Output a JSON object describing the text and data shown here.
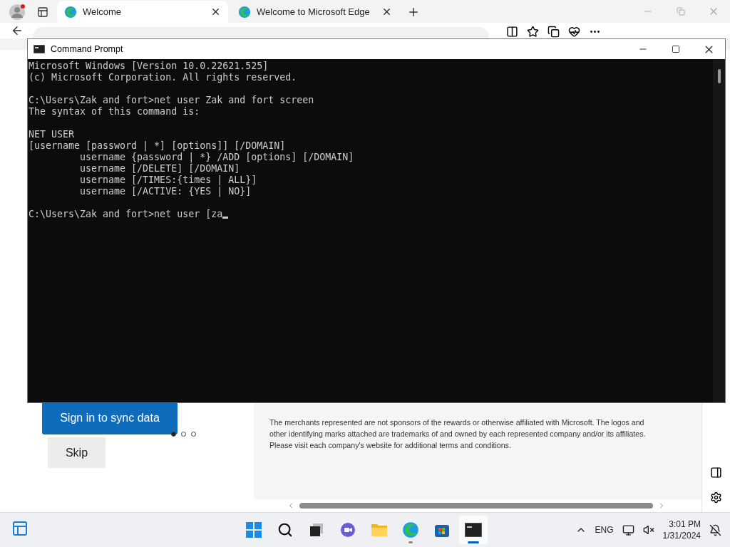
{
  "browser": {
    "tabs": [
      {
        "label": "Welcome",
        "selected": true
      },
      {
        "label": "Welcome to Microsoft Edge",
        "selected": false
      }
    ],
    "page": {
      "sign_in_button": "Sign in to sync data",
      "skip_button": "Skip",
      "carousel_dots": [
        {
          "selected": true
        },
        {
          "selected": false
        },
        {
          "selected": false
        }
      ],
      "disclaimer": "The merchants represented are not sponsors of the rewards or otherwise affiliated with Microsoft. The logos and other identifying marks attached are trademarks of and owned by each represented company and/or its affiliates. Please visit each company's website for additional terms and conditions."
    }
  },
  "command_prompt": {
    "title": "Command Prompt",
    "cursor": true,
    "blocks": [
      [
        "Microsoft Windows [Version 10.0.22621.525]",
        "(c) Microsoft Corporation. All rights reserved."
      ],
      [
        "C:\\Users\\Zak and fort>net user Zak and fort screen",
        "The syntax of this command is:"
      ],
      [
        "NET USER",
        "[username [password | *] [options]] [/DOMAIN]",
        "         username {password | *} /ADD [options] [/DOMAIN]",
        "         username [/DELETE] [/DOMAIN]",
        "         username [/TIMES:{times | ALL}]",
        "         username [/ACTIVE: {YES | NO}]"
      ],
      [
        "C:\\Users\\Zak and fort>net user [za"
      ]
    ]
  },
  "taskbar": {
    "apps": [
      {
        "kind": "start",
        "running": false,
        "active": false
      },
      {
        "kind": "search",
        "running": false,
        "active": false
      },
      {
        "kind": "taskview",
        "running": false,
        "active": false
      },
      {
        "kind": "chat",
        "running": false,
        "active": false
      },
      {
        "kind": "files",
        "running": false,
        "active": false
      },
      {
        "kind": "edge",
        "running": true,
        "active": false
      },
      {
        "kind": "store",
        "running": false,
        "active": false
      },
      {
        "kind": "terminal",
        "running": true,
        "active": true
      }
    ],
    "tray": {
      "language": "ENG",
      "time": "3:01 PM",
      "date": "1/31/2024"
    }
  }
}
